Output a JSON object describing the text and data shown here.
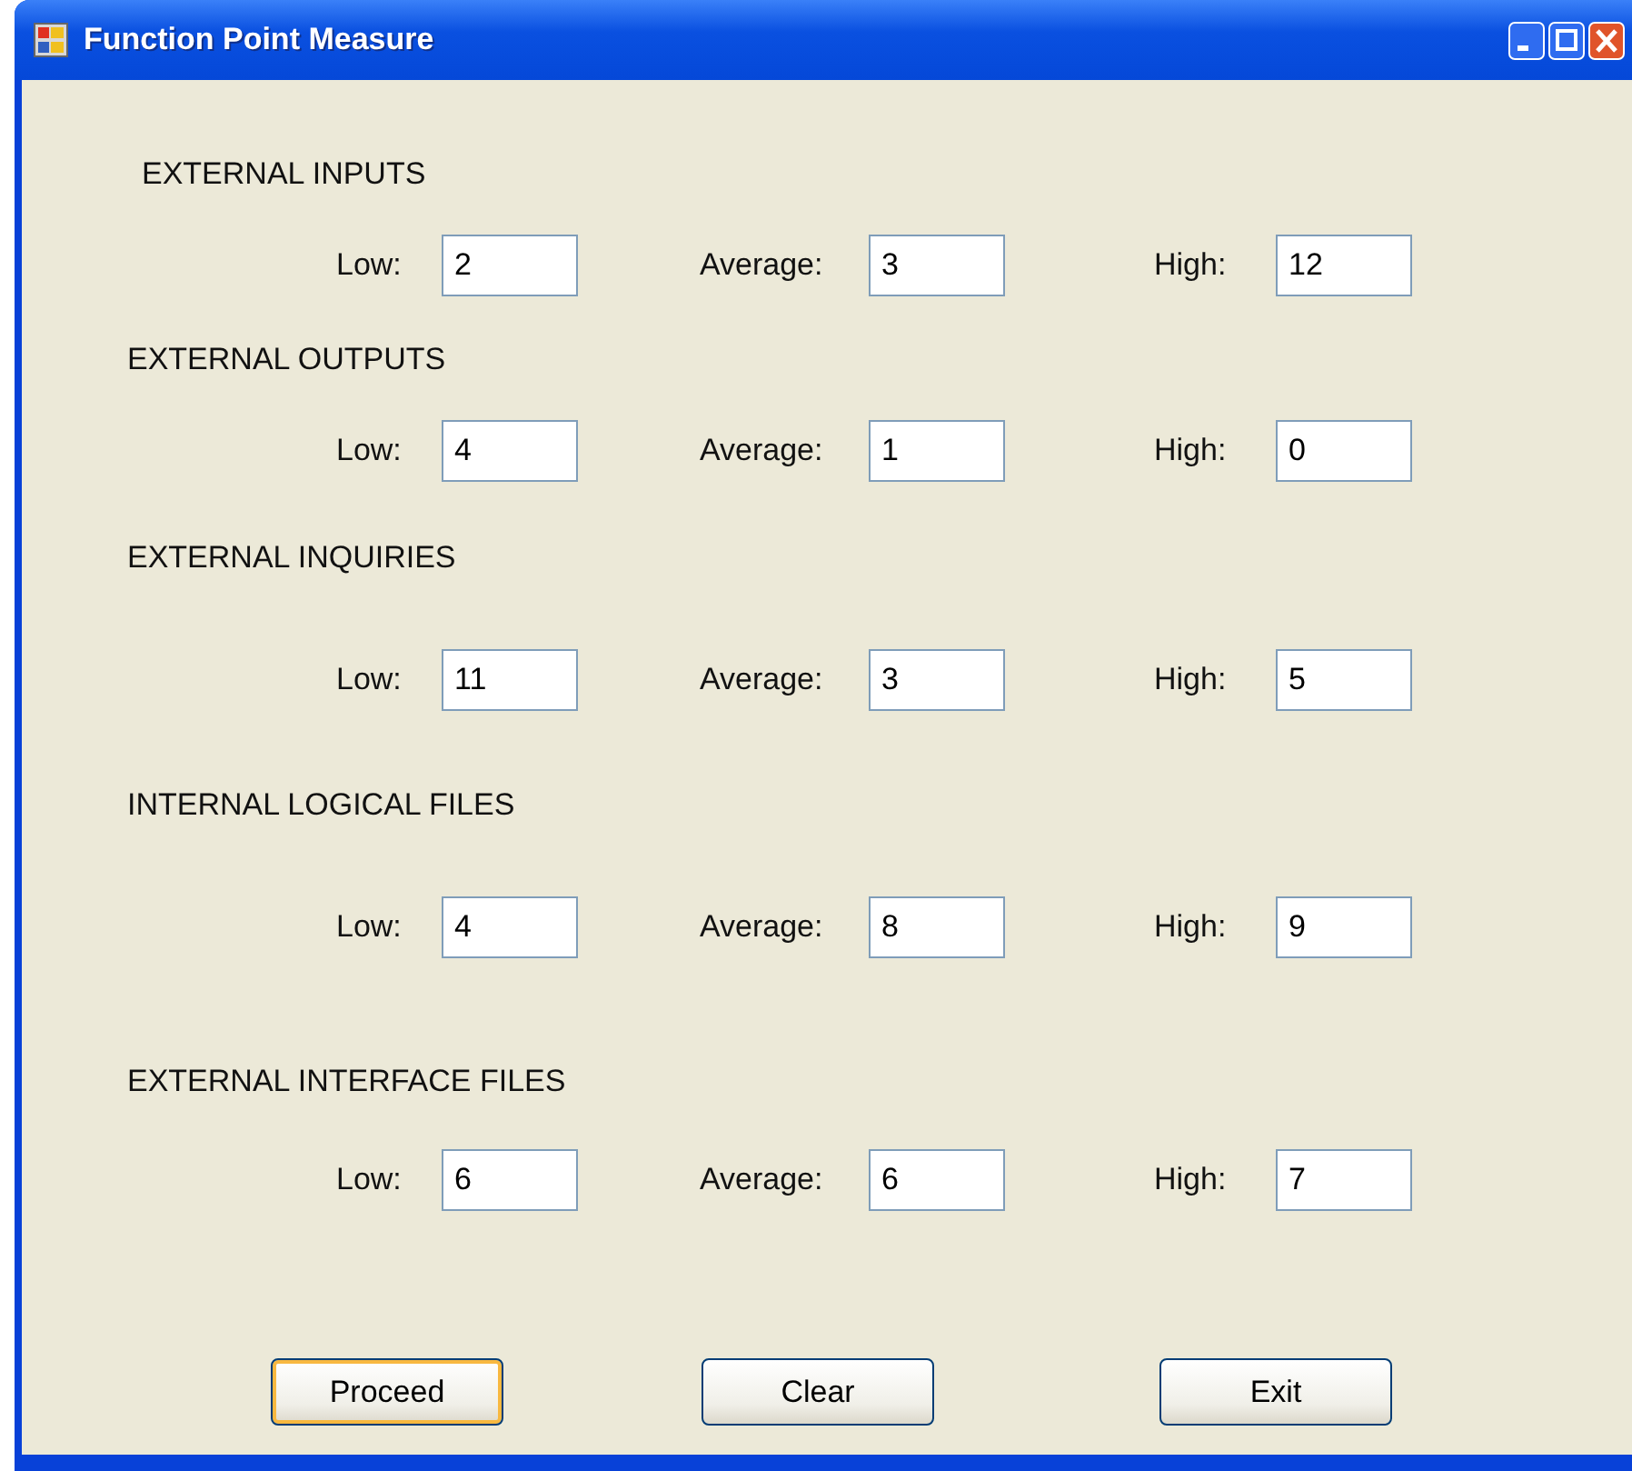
{
  "window": {
    "title": "Function Point Measure"
  },
  "sections": [
    {
      "heading": "EXTERNAL INPUTS",
      "fields": [
        {
          "label": "Low:",
          "value": "2"
        },
        {
          "label": "Average:",
          "value": "3"
        },
        {
          "label": "High:",
          "value": "12"
        }
      ]
    },
    {
      "heading": "EXTERNAL OUTPUTS",
      "fields": [
        {
          "label": "Low:",
          "value": "4"
        },
        {
          "label": "Average:",
          "value": "1"
        },
        {
          "label": "High:",
          "value": "0"
        }
      ]
    },
    {
      "heading": "EXTERNAL INQUIRIES",
      "fields": [
        {
          "label": "Low:",
          "value": "11"
        },
        {
          "label": "Average:",
          "value": "3"
        },
        {
          "label": "High:",
          "value": "5"
        }
      ]
    },
    {
      "heading": "INTERNAL LOGICAL FILES",
      "fields": [
        {
          "label": "Low:",
          "value": "4"
        },
        {
          "label": "Average:",
          "value": "8"
        },
        {
          "label": "High:",
          "value": "9"
        }
      ]
    },
    {
      "heading": "EXTERNAL INTERFACE FILES",
      "fields": [
        {
          "label": "Low:",
          "value": "6"
        },
        {
          "label": "Average:",
          "value": "6"
        },
        {
          "label": "High:",
          "value": "7"
        }
      ]
    }
  ],
  "buttons": [
    {
      "label": "Proceed",
      "default": true
    },
    {
      "label": "Clear",
      "default": false
    },
    {
      "label": "Exit",
      "default": false
    }
  ]
}
